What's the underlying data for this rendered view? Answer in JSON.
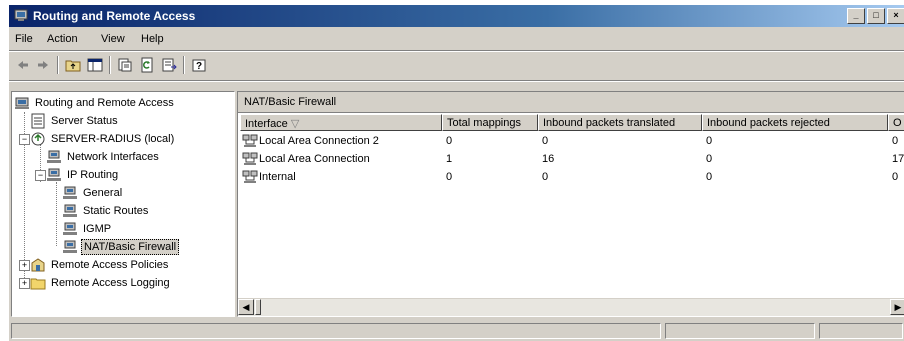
{
  "window": {
    "title": "Routing and Remote Access",
    "buttons": {
      "minimize": "_",
      "maximize": "□",
      "close": "×"
    }
  },
  "menu": [
    {
      "label": "File",
      "underline": "F"
    },
    {
      "label": "Action",
      "underline": "A"
    },
    {
      "label": "View",
      "underline": "V"
    },
    {
      "label": "Help",
      "underline": "H"
    }
  ],
  "toolbar": {
    "icons": [
      "back-arrow-icon",
      "forward-arrow-icon",
      "up-folder-icon",
      "show-hide-tree-icon",
      "properties-icon",
      "refresh-icon",
      "export-list-icon",
      "help-icon"
    ]
  },
  "tree": {
    "root": "Routing and Remote Access",
    "items": [
      {
        "label": "Server Status"
      },
      {
        "label": "SERVER-RADIUS (local)"
      },
      {
        "label": "Network Interfaces"
      },
      {
        "label": "IP Routing"
      },
      {
        "label": "General"
      },
      {
        "label": "Static Routes"
      },
      {
        "label": "IGMP"
      },
      {
        "label": "NAT/Basic Firewall"
      },
      {
        "label": "Remote Access Policies"
      },
      {
        "label": "Remote Access Logging"
      }
    ],
    "selected": "NAT/Basic Firewall"
  },
  "panel": {
    "title": "NAT/Basic Firewall",
    "columns": [
      "Interface",
      "Total mappings",
      "Inbound packets translated",
      "Inbound packets rejected",
      "O"
    ],
    "rows": [
      [
        "Local Area Connection 2",
        "0",
        "0",
        "0",
        "0"
      ],
      [
        "Local Area Connection",
        "1",
        "16",
        "0",
        "17"
      ],
      [
        "Internal",
        "0",
        "0",
        "0",
        "0"
      ]
    ]
  },
  "colors": {
    "title_start": "#0a246a",
    "title_end": "#a6caf0",
    "chrome": "#d4d0c8"
  }
}
